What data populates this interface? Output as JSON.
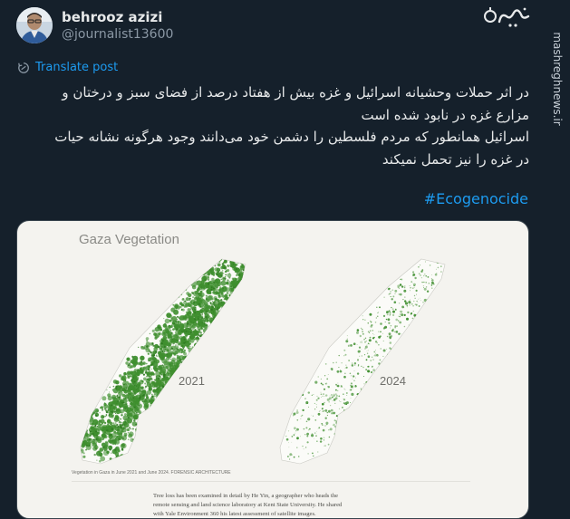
{
  "author": {
    "name": "behrooz azizi",
    "handle": "@journalist13600"
  },
  "watermark": {
    "vertical_text": "mashreghnews.ir",
    "logo": "mashregh-logo"
  },
  "translate_label": "Translate post",
  "post_lines": [
    "در اثر حملات وحشیانه اسرائیل و غزه بیش از هفتاد درصد از فضای سبز و درختان و",
    "مزارع غزه در نابود شده است",
    "اسرائیل همانطور که مردم فلسطین را دشمن خود می‌دانند وجود هرگونه نشانه حیات",
    "در غزه را نیز تحمل نمیکند"
  ],
  "hashtag": "#Ecogenocide",
  "media": {
    "title": "Gaza Vegetation",
    "label_2021": "2021",
    "label_2024": "2024",
    "caption": "Vegetation in Gaza in June 2021 and June 2024. FORENSIC ARCHITECTURE",
    "article_lines": [
      "Tree loss has been examined in detail by He Yin, a geographer who heads the",
      "remote sensing and land science laboratory at Kent State University. He shared",
      "with Yale Environment 360 his latest assessment of satellite images."
    ]
  },
  "colors": {
    "background": "#15202b",
    "link": "#1d9bf0",
    "vegetation": "#3f8f2f",
    "card": "#f4f3ef"
  }
}
